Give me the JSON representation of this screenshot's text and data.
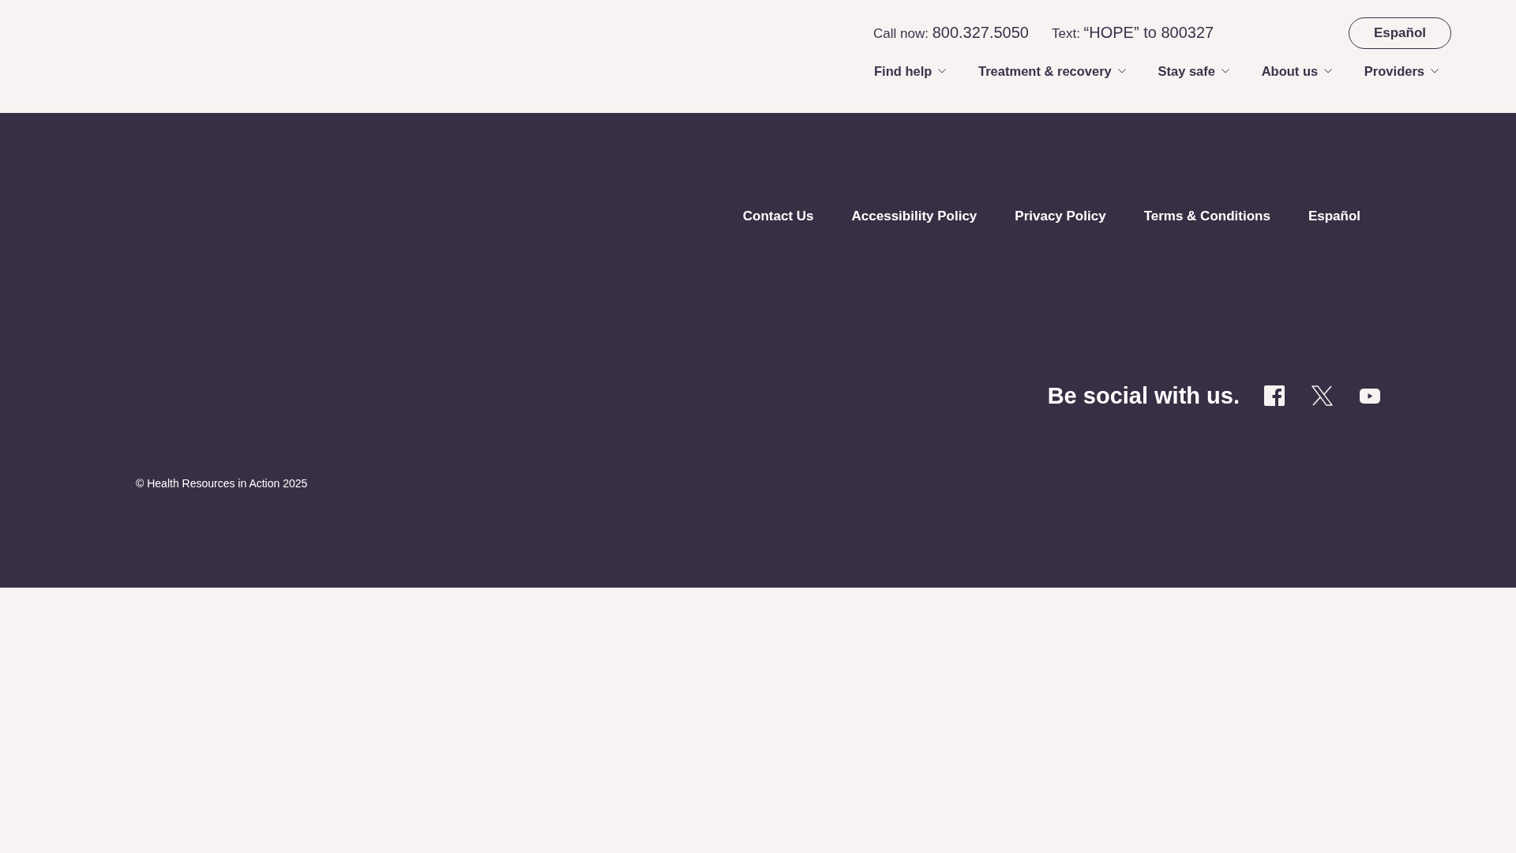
{
  "header": {
    "contact": [
      {
        "label": "Call now:",
        "value": "800.327.5050"
      },
      {
        "label": "Text:",
        "value": "“HOPE” to 800327"
      }
    ],
    "language_button": "Español",
    "nav": [
      "Find help",
      "Treatment & recovery",
      "Stay safe",
      "About us",
      "Providers"
    ]
  },
  "footer": {
    "links": [
      "Contact Us",
      "Accessibility Policy",
      "Privacy Policy",
      "Terms & Conditions",
      "Español"
    ],
    "social_heading": "Be social with us.",
    "copyright": "© Health Resources in Action 2025"
  }
}
